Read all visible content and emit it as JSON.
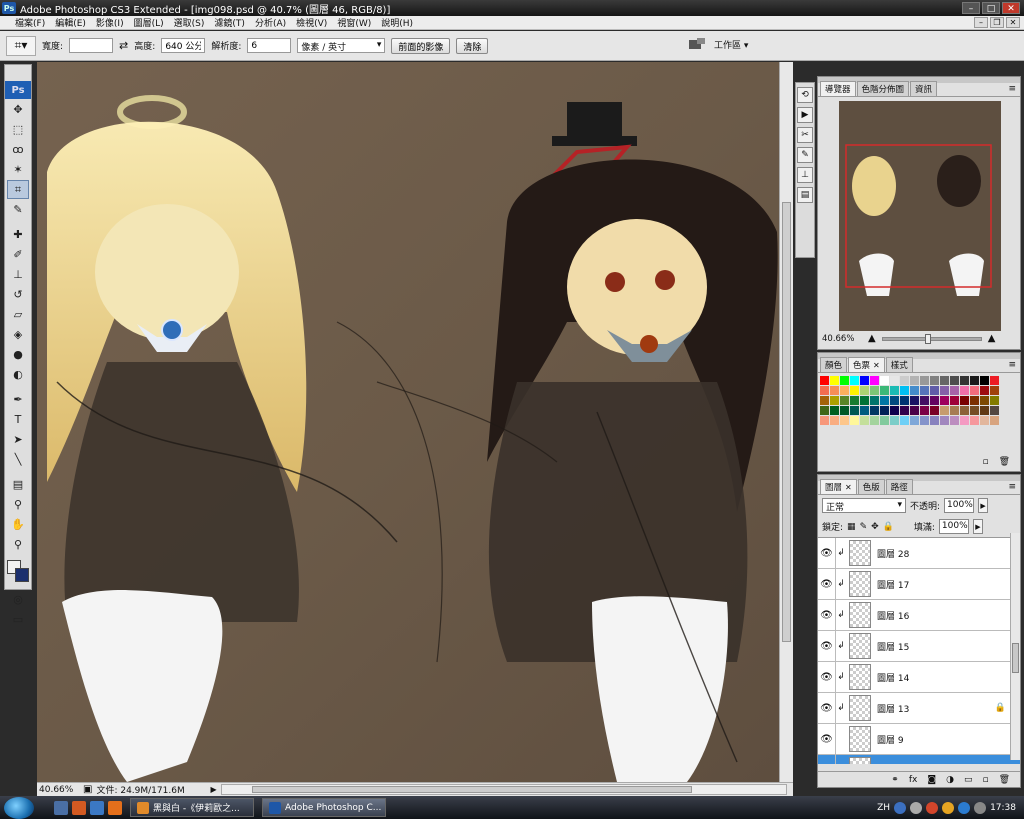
{
  "window": {
    "title": "Adobe Photoshop CS3 Extended - [img098.psd @ 40.7% (圖層 46, RGB/8)]",
    "app_badge": "Ps"
  },
  "menu": [
    "檔案(F)",
    "編輯(E)",
    "影像(I)",
    "圖層(L)",
    "選取(S)",
    "濾鏡(T)",
    "分析(A)",
    "檢視(V)",
    "視窗(W)",
    "說明(H)"
  ],
  "options": {
    "width_label": "寬度:",
    "width_value": "",
    "height_label": "高度:",
    "height_value": "640 公分",
    "resolution_label": "解析度:",
    "resolution_value": "6",
    "unit_value": "像素 / 英寸",
    "front_image_button": "前面的影像",
    "clear_button": "清除",
    "workspace_label": "工作區 ▾"
  },
  "toolbox": {
    "logo": "Ps"
  },
  "status": {
    "zoom": "40.66%",
    "doc_info": "文件: 24.9M/171.6M"
  },
  "navigator": {
    "tabs": [
      "導覽器",
      "色階分佈圖",
      "資訊"
    ],
    "zoom": "40.66%"
  },
  "swatch_panel": {
    "tabs": [
      "顏色",
      "色票",
      "樣式"
    ],
    "colors": [
      "#ff0000",
      "#ffff00",
      "#00ff00",
      "#00ffff",
      "#0000ff",
      "#ff00ff",
      "#ffffff",
      "#e6e6e6",
      "#cccccc",
      "#b3b3b3",
      "#999999",
      "#808080",
      "#666666",
      "#4d4d4d",
      "#333333",
      "#1a1a1a",
      "#000000",
      "#ed1c24",
      "#f26c4f",
      "#f68e56",
      "#fbaf5d",
      "#fff200",
      "#acd373",
      "#7cc576",
      "#3bb878",
      "#1abbb4",
      "#00bff3",
      "#448ccb",
      "#5674b9",
      "#605ca8",
      "#8560a8",
      "#a763a8",
      "#f06ea9",
      "#f26d7d",
      "#9e0b0f",
      "#a0410d",
      "#a36209",
      "#aba000",
      "#598527",
      "#197b30",
      "#007236",
      "#00746b",
      "#0076a3",
      "#004a80",
      "#003471",
      "#1b1464",
      "#440e62",
      "#630460",
      "#9e005d",
      "#9e0039",
      "#790000",
      "#7b2e00",
      "#7d4900",
      "#827b00",
      "#406618",
      "#005e20",
      "#005826",
      "#005952",
      "#005b7f",
      "#003663",
      "#002157",
      "#0d004c",
      "#32004b",
      "#4b0049",
      "#7b0046",
      "#7a0026",
      "#c69c6d",
      "#a67c52",
      "#8c6239",
      "#754c24",
      "#603913",
      "#534741",
      "#f7977a",
      "#f9ad81",
      "#fdc68a",
      "#fff79a",
      "#c4df9b",
      "#a3d39c",
      "#82ca9d",
      "#7bcdc8",
      "#6ecff6",
      "#7ea7d8",
      "#8493ca",
      "#8882be",
      "#a187be",
      "#bc8dbf",
      "#f49ac2",
      "#f6989d",
      "#e2b69c",
      "#d8a47f"
    ]
  },
  "layers": {
    "tabs": [
      "圖層",
      "色版",
      "路徑"
    ],
    "blend_mode": "正常",
    "opacity_label": "不透明:",
    "opacity_value": "100%",
    "lock_label": "鎖定:",
    "fill_label": "填滿:",
    "fill_value": "100%",
    "items": [
      {
        "name": "圖層 28",
        "clipped": true,
        "visible": true,
        "locked": false,
        "selected": false
      },
      {
        "name": "圖層 17",
        "clipped": true,
        "visible": true,
        "locked": false,
        "selected": false
      },
      {
        "name": "圖層 16",
        "clipped": true,
        "visible": true,
        "locked": false,
        "selected": false
      },
      {
        "name": "圖層 15",
        "clipped": true,
        "visible": true,
        "locked": false,
        "selected": false
      },
      {
        "name": "圖層 14",
        "clipped": true,
        "visible": true,
        "locked": false,
        "selected": false
      },
      {
        "name": "圖層 13",
        "clipped": true,
        "visible": true,
        "locked": true,
        "selected": false
      },
      {
        "name": "圖層 9",
        "clipped": false,
        "visible": true,
        "locked": false,
        "selected": false
      },
      {
        "name": "圖層 46",
        "clipped": true,
        "visible": true,
        "locked": false,
        "selected": true
      }
    ]
  },
  "taskbar": {
    "tasks": [
      {
        "label": "黑與白 -《伊莉歐之...",
        "active": false,
        "color": "#e08a2a"
      },
      {
        "label": "Adobe Photoshop C...",
        "active": true,
        "color": "#1e57a8"
      }
    ],
    "ime": "ZH",
    "clock": "17:38"
  }
}
